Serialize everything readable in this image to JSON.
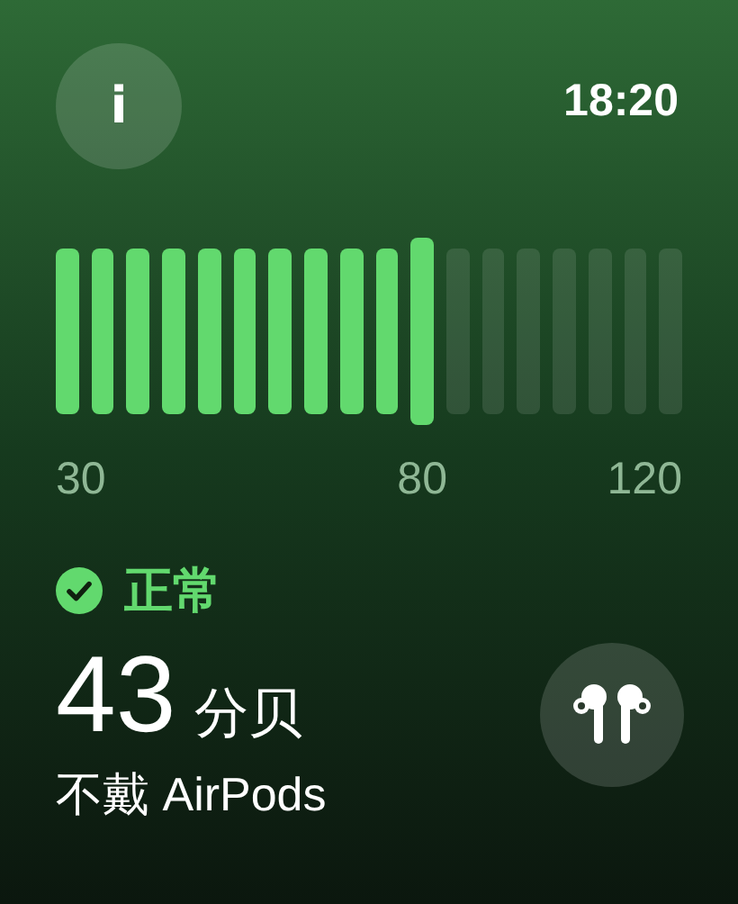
{
  "info_button": {
    "label": "i"
  },
  "time": "18:20",
  "meter": {
    "level": 0.611,
    "ticks": [
      "30",
      "80",
      "120"
    ]
  },
  "status": {
    "label": "正常",
    "ok": true
  },
  "reading": {
    "value": "43",
    "unit": "分贝"
  },
  "source": "不戴 AirPods"
}
